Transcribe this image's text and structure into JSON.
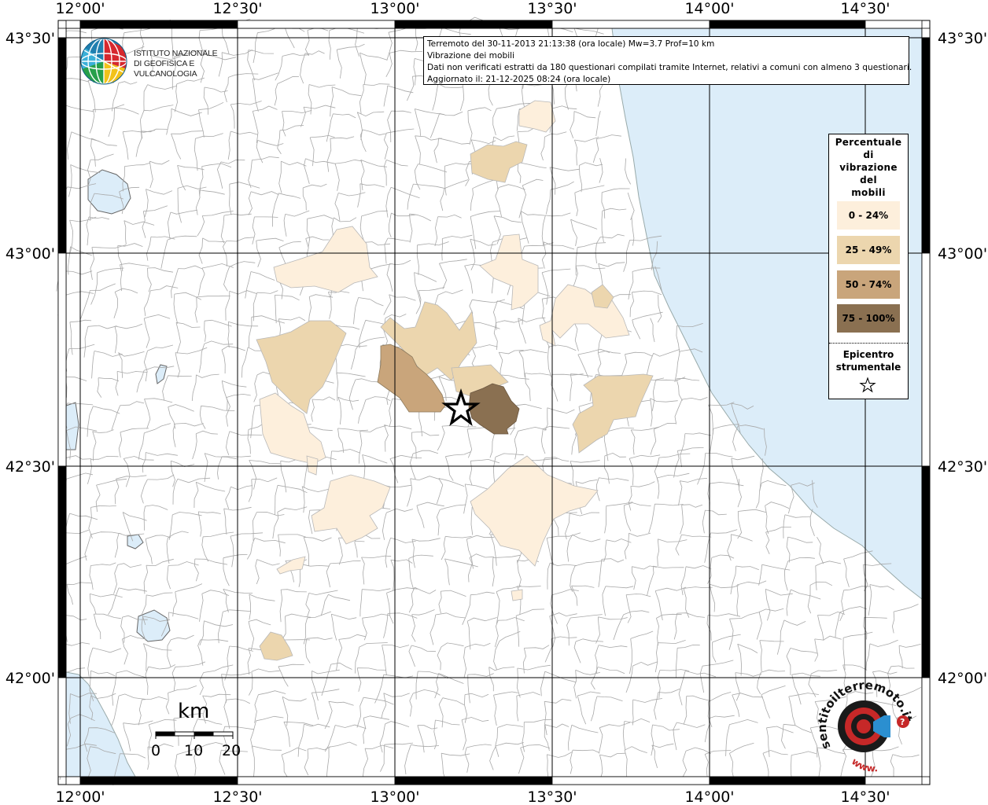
{
  "header": {
    "line1": "Terremoto del 30-11-2013 21:13:38 (ora locale) Mw=3.7 Prof=10 km",
    "line2": "Vibrazione dei mobili",
    "line3": "Dati non verificati estratti da 180 questionari compilati tramite Internet, relativi a comuni con almeno 3 questionari.",
    "line4": "Aggiornato il: 21-12-2025 08:24 (ora locale)"
  },
  "logo": {
    "name": "ISTITUTO NAZIONALE\nDI GEOFISICA E VULCANOLOGIA"
  },
  "axes": {
    "top_labels": [
      "12°00'",
      "12°30'",
      "13°00'",
      "13°30'",
      "14°00'",
      "14°30'"
    ],
    "bottom_labels": [
      "12°00'",
      "12°30'",
      "13°00'",
      "13°30'",
      "14°00'",
      "14°30'"
    ],
    "left_labels": [
      "43°30'",
      "43°00'",
      "42°30'",
      "42°00'"
    ],
    "right_labels": [
      "43°30'",
      "43°00'",
      "42°30'",
      "42°00'"
    ]
  },
  "legend": {
    "title": "Percentuale\ndi\nvibrazione\ndel\nmobili",
    "classes": [
      {
        "label": "0 - 24%",
        "color": "#fdefdc"
      },
      {
        "label": "25 - 49%",
        "color": "#ecd6ae"
      },
      {
        "label": "50 - 74%",
        "color": "#c9a57b"
      },
      {
        "label": "75 - 100%",
        "color": "#8a7051"
      }
    ],
    "epicenter_title": "Epicentro\nstrumentale"
  },
  "scale_bar": {
    "unit": "km",
    "labels": [
      "0",
      "10",
      "20"
    ]
  },
  "brand": {
    "text": "sentitoilterremoto.it",
    "sub": "www."
  },
  "colors": {
    "sea": "#dcedf9",
    "border": "#a0a0a0",
    "grid": "#000000"
  }
}
